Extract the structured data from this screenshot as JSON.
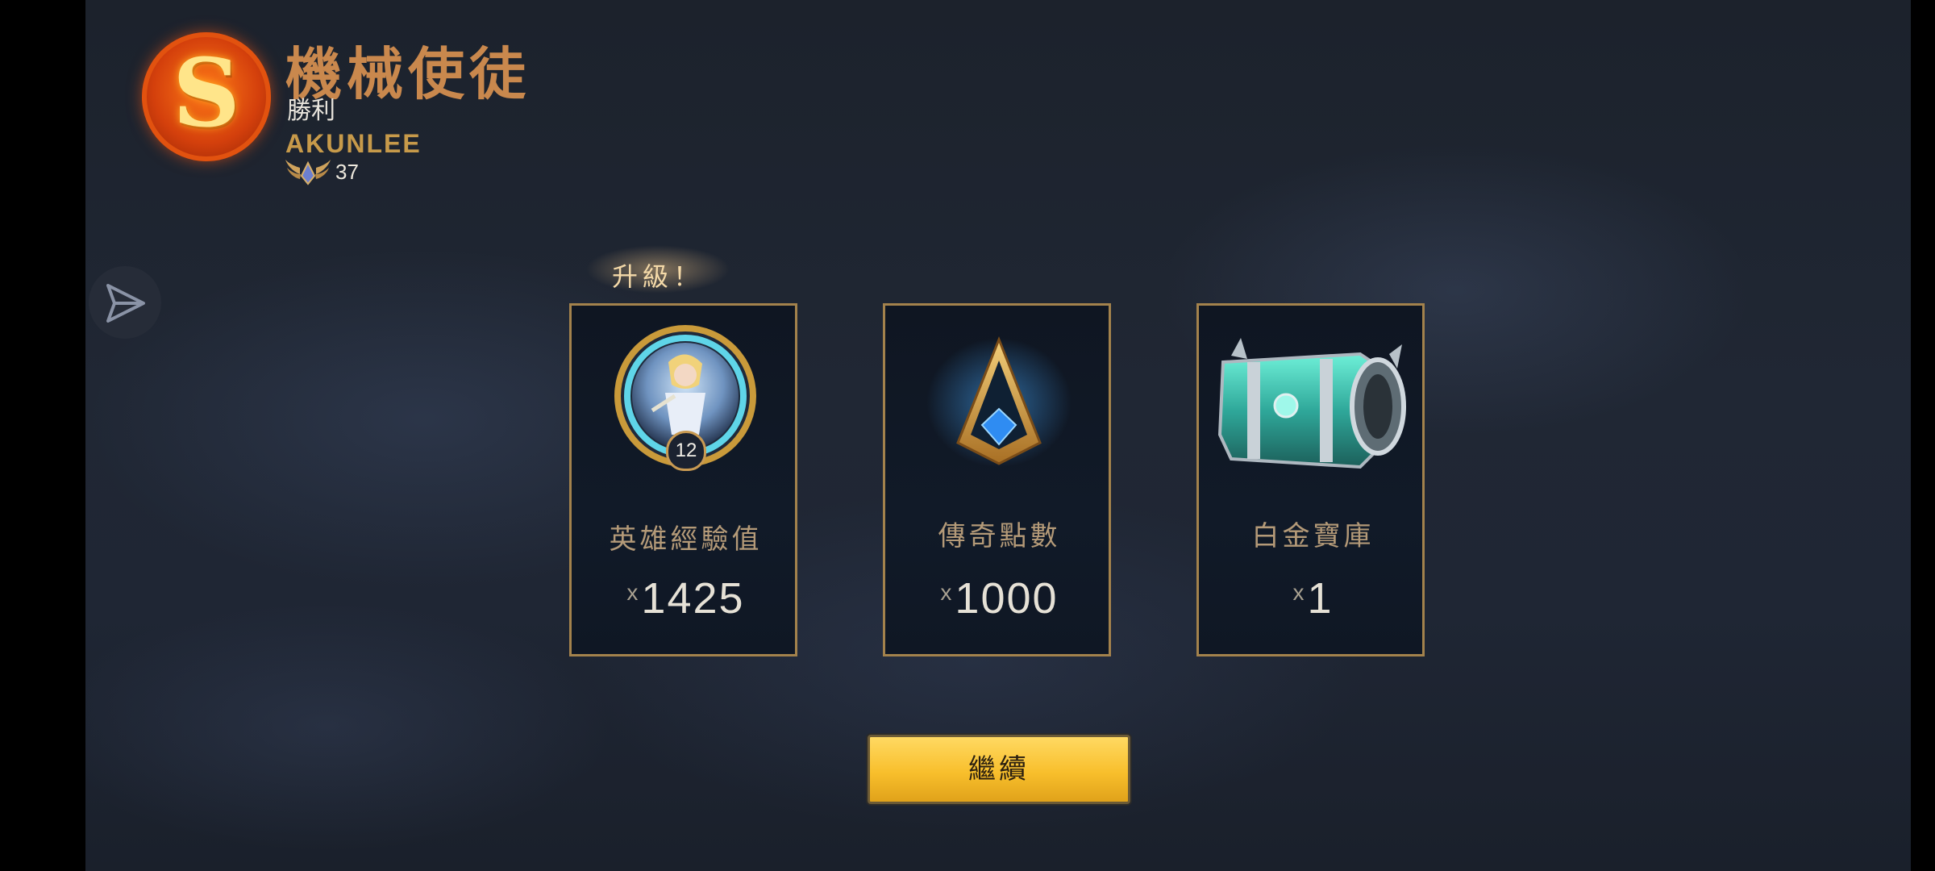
{
  "header": {
    "grade": "S",
    "champion_name": "機械使徒",
    "result": "勝利",
    "player_name": "AKUNLEE",
    "account_level": "37"
  },
  "level_up_label": "升級！",
  "rewards": [
    {
      "label": "英雄經驗值",
      "qty_prefix": "x",
      "qty": "1425",
      "icon": "champion-portrait-icon",
      "badge_level": "12"
    },
    {
      "label": "傳奇點數",
      "qty_prefix": "x",
      "qty": "1000",
      "icon": "legend-points-icon"
    },
    {
      "label": "白金寶庫",
      "qty_prefix": "x",
      "qty": "1",
      "icon": "platinum-vault-chest-icon"
    }
  ],
  "continue_label": "繼續",
  "colors": {
    "gold_border": "#a3824c",
    "button_yellow": "#f8bf2c",
    "grade_orange": "#e2520f"
  }
}
